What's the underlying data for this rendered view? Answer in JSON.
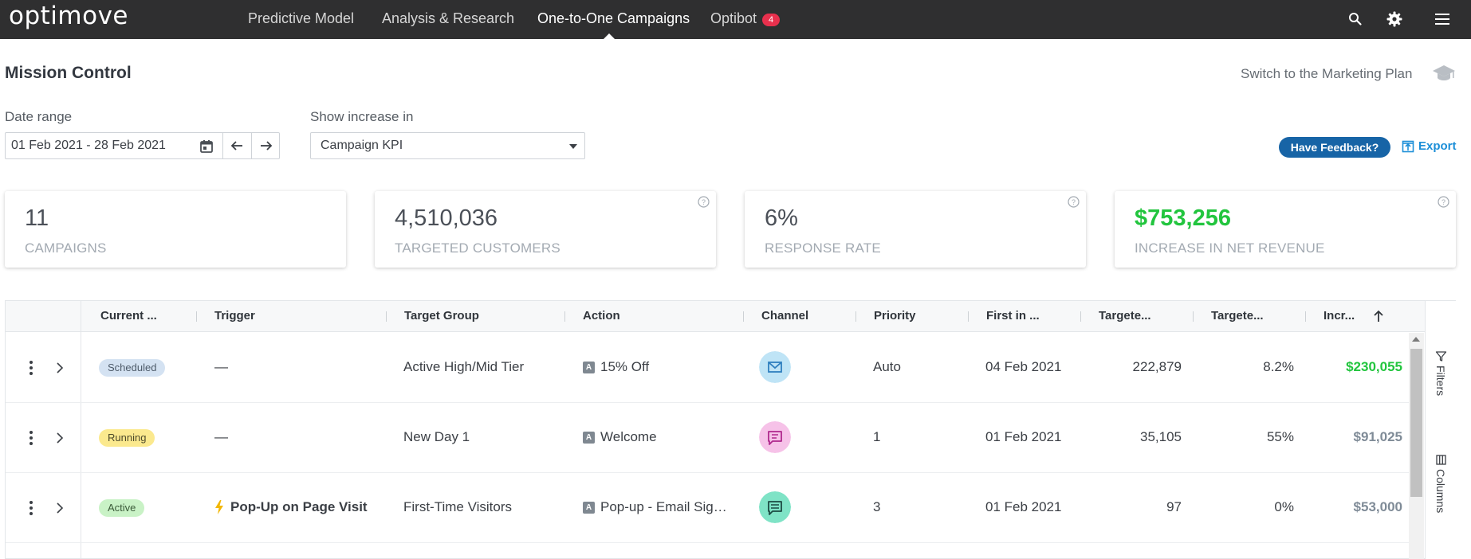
{
  "app": {
    "logo": "optimove",
    "nav": [
      {
        "label": "Predictive Model"
      },
      {
        "label": "Analysis & Research"
      },
      {
        "label": "One-to-One Campaigns"
      },
      {
        "label": "Optibot"
      }
    ],
    "optibot_badge": "4",
    "icons": [
      "search-icon",
      "gear-icon",
      "hamburger-menu-icon"
    ]
  },
  "header": {
    "title": "Mission Control",
    "switch_link": "Switch to the Marketing Plan"
  },
  "filters": {
    "date_label": "Date range",
    "date_value": "01 Feb 2021 - 28 Feb 2021",
    "increase_label": "Show increase in",
    "increase_value": "Campaign KPI",
    "feedback_button": "Have Feedback?",
    "export_link": "Export"
  },
  "kpis": [
    {
      "value": "11",
      "label": "CAMPAIGNS"
    },
    {
      "value": "4,510,036",
      "label": "TARGETED CUSTOMERS"
    },
    {
      "value": "6%",
      "label": "RESPONSE RATE"
    },
    {
      "value": "$753,256",
      "label": "INCREASE IN NET REVENUE"
    }
  ],
  "table": {
    "columns": [
      {
        "label": "Current ..."
      },
      {
        "label": "Trigger"
      },
      {
        "label": "Target Group"
      },
      {
        "label": "Action"
      },
      {
        "label": "Channel"
      },
      {
        "label": "Priority"
      },
      {
        "label": "First in ..."
      },
      {
        "label": "Targete..."
      },
      {
        "label": "Targete..."
      },
      {
        "label": "Incr..."
      }
    ],
    "rows": [
      {
        "status": "Scheduled",
        "trigger": "—",
        "target_group": "Active High/Mid Tier",
        "action": "15% Off",
        "action_tag": "A",
        "channel": "email-icon",
        "priority": "Auto",
        "first_in": "04 Feb 2021",
        "targeted": "222,879",
        "targeted_pct": "8.2%",
        "increase": "$230,055"
      },
      {
        "status": "Running",
        "trigger": "—",
        "target_group": "New Day 1",
        "action": "Welcome",
        "action_tag": "A",
        "channel": "chat-message-icon",
        "priority": "1",
        "first_in": "01 Feb 2021",
        "targeted": "35,105",
        "targeted_pct": "55%",
        "increase": "$91,025"
      },
      {
        "status": "Active",
        "trigger": "Pop-Up on Page Visit",
        "target_group": "First-Time Visitors",
        "action": "Pop-up - Email Sig…",
        "action_tag": "A",
        "channel": "web-popup-icon",
        "priority": "3",
        "first_in": "01 Feb 2021",
        "targeted": "97",
        "targeted_pct": "0%",
        "increase": "$53,000"
      }
    ],
    "side_tabs": [
      {
        "label": "Filters"
      },
      {
        "label": "Columns"
      }
    ]
  },
  "colors": {
    "topbar": "#2f2f30",
    "brand_blue": "#1764a6",
    "positive_green": "#22c53e",
    "muted_revenue": "#7f8b97"
  }
}
